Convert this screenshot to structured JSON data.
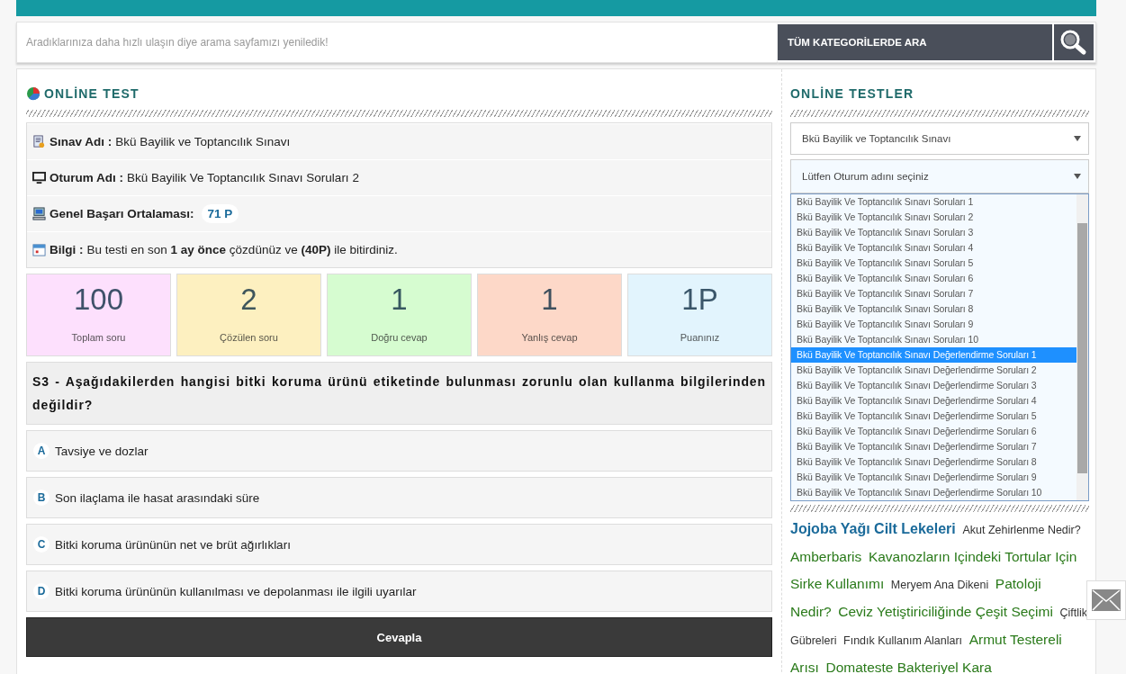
{
  "search": {
    "placeholder": "Aradıklarınıza daha hızlı ulaşın diye arama sayfamızı yeniledik!",
    "button": "TÜM KATEGORİLERDE ARA"
  },
  "test": {
    "title": "ONLİNE TEST",
    "info": [
      {
        "kind": "exam",
        "label": "Sınav Adı :",
        "value": "Bkü Bayilik ve Toptancılık Sınavı"
      },
      {
        "kind": "session",
        "label": "Oturum Adı :",
        "value": "Bkü Bayilik Ve Toptancılık Sınavı Soruları 2"
      },
      {
        "kind": "average",
        "label": "Genel Başarı Ortalaması:",
        "value": "71 P"
      },
      {
        "kind": "note",
        "label": "Bilgi :",
        "value": "Bu testi en son **1 ay önce** çözdünüz ve **(40P)** ile bitirdiniz."
      }
    ],
    "stats": [
      {
        "value": "100",
        "label": "Toplam soru",
        "color": "#fde0fd"
      },
      {
        "value": "2",
        "label": "Çözülen soru",
        "color": "#fdf0c0"
      },
      {
        "value": "1",
        "label": "Doğru cevap",
        "color": "#d6fcd0"
      },
      {
        "value": "1",
        "label": "Yanlış cevap",
        "color": "#fdd8c8"
      },
      {
        "value": "1P",
        "label": "Puanınız",
        "color": "#e2f4fd"
      }
    ],
    "question": "S3 - Aşağıdakilerden hangisi bitki koruma ürünü etiketinde bulunması zorunlu olan kullanma bilgilerinden değildir?",
    "answers": [
      {
        "letter": "A",
        "text": "Tavsiye ve dozlar"
      },
      {
        "letter": "B",
        "text": "Son ilaçlama ile hasat arasındaki süre"
      },
      {
        "letter": "C",
        "text": "Bitki koruma ürününün net ve brüt ağırlıkları"
      },
      {
        "letter": "D",
        "text": "Bitki koruma ürününün kullanılması ve depolanması ile ilgili uyarılar"
      }
    ],
    "submit": "Cevapla"
  },
  "sidebar": {
    "title": "ONLİNE TESTLER",
    "exam_select": "Bkü Bayilik ve Toptancılık Sınavı",
    "session_select": "Lütfen Oturum adını seçiniz",
    "options": [
      {
        "label": "Bkü Bayilik Ve Toptancılık Sınavı Soruları 1",
        "selected": false
      },
      {
        "label": "Bkü Bayilik Ve Toptancılık Sınavı Soruları 2",
        "selected": false
      },
      {
        "label": "Bkü Bayilik Ve Toptancılık Sınavı Soruları 3",
        "selected": false
      },
      {
        "label": "Bkü Bayilik Ve Toptancılık Sınavı Soruları 4",
        "selected": false
      },
      {
        "label": "Bkü Bayilik Ve Toptancılık Sınavı Soruları 5",
        "selected": false
      },
      {
        "label": "Bkü Bayilik Ve Toptancılık Sınavı Soruları 6",
        "selected": false
      },
      {
        "label": "Bkü Bayilik Ve Toptancılık Sınavı Soruları 7",
        "selected": false
      },
      {
        "label": "Bkü Bayilik Ve Toptancılık Sınavı Soruları 8",
        "selected": false
      },
      {
        "label": "Bkü Bayilik Ve Toptancılık Sınavı Soruları 9",
        "selected": false
      },
      {
        "label": "Bkü Bayilik Ve Toptancılık Sınavı Soruları 10",
        "selected": false
      },
      {
        "label": "Bkü Bayilik Ve Toptancılık Sınavı Değerlendirme Soruları 1",
        "selected": true
      },
      {
        "label": "Bkü Bayilik Ve Toptancılık Sınavı Değerlendirme Soruları 2",
        "selected": false
      },
      {
        "label": "Bkü Bayilik Ve Toptancılık Sınavı Değerlendirme Soruları 3",
        "selected": false
      },
      {
        "label": "Bkü Bayilik Ve Toptancılık Sınavı Değerlendirme Soruları 4",
        "selected": false
      },
      {
        "label": "Bkü Bayilik Ve Toptancılık Sınavı Değerlendirme Soruları 5",
        "selected": false
      },
      {
        "label": "Bkü Bayilik Ve Toptancılık Sınavı Değerlendirme Soruları 6",
        "selected": false
      },
      {
        "label": "Bkü Bayilik Ve Toptancılık Sınavı Değerlendirme Soruları 7",
        "selected": false
      },
      {
        "label": "Bkü Bayilik Ve Toptancılık Sınavı Değerlendirme Soruları 8",
        "selected": false
      },
      {
        "label": "Bkü Bayilik Ve Toptancılık Sınavı Değerlendirme Soruları 9",
        "selected": false
      },
      {
        "label": "Bkü Bayilik Ve Toptancılık Sınavı Değerlendirme Soruları 10",
        "selected": false
      }
    ],
    "tags": [
      {
        "text": "Jojoba Yağı Cilt Lekeleri",
        "kind": "featured"
      },
      {
        "text": "Akut Zehirlenme Nedir?",
        "kind": "small"
      },
      {
        "text": "Amberbaris",
        "kind": "large"
      },
      {
        "text": "Kavanozların Içindeki Tortular Için Sirke Kullanımı",
        "kind": "large"
      },
      {
        "text": "Meryem Ana Dikeni",
        "kind": "small"
      },
      {
        "text": "Patoloji Nedir?",
        "kind": "large"
      },
      {
        "text": "Ceviz Yetiştiriciliğinde Çeşit Seçimi",
        "kind": "large"
      },
      {
        "text": "Çiftlik Gübreleri",
        "kind": "small"
      },
      {
        "text": "Fındık Kullanım Alanları",
        "kind": "small"
      },
      {
        "text": "Armut Testereli Arısı",
        "kind": "large"
      },
      {
        "text": "Domateste Bakteriyel Kara",
        "kind": "large"
      }
    ]
  }
}
